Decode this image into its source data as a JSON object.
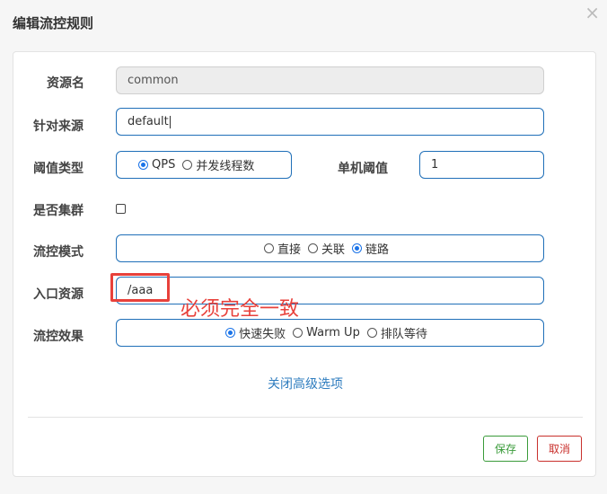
{
  "dialog": {
    "title": "编辑流控规则",
    "close_glyph": "×"
  },
  "form": {
    "resource_name": {
      "label": "资源名",
      "value": "common"
    },
    "limit_app": {
      "label": "针对来源",
      "value": "default"
    },
    "threshold_type": {
      "label": "阈值类型",
      "options": [
        {
          "label": "QPS",
          "checked": true
        },
        {
          "label": "并发线程数",
          "checked": false
        }
      ]
    },
    "single_threshold": {
      "label": "单机阈值",
      "value": "1"
    },
    "cluster_mode": {
      "label": "是否集群",
      "checked": false
    },
    "strategy": {
      "label": "流控模式",
      "options": [
        {
          "label": "直接",
          "checked": false
        },
        {
          "label": "关联",
          "checked": false
        },
        {
          "label": "链路",
          "checked": true
        }
      ]
    },
    "ref_resource": {
      "label": "入口资源",
      "value": "/aaa"
    },
    "control_behavior": {
      "label": "流控效果",
      "options": [
        {
          "label": "快速失败",
          "checked": true
        },
        {
          "label": "Warm Up",
          "checked": false
        },
        {
          "label": "排队等待",
          "checked": false
        }
      ]
    }
  },
  "annotation": {
    "text": "必须完全一致",
    "color": "#e8413b"
  },
  "advanced_toggle": "关闭高级选项",
  "buttons": {
    "save": "保存",
    "cancel": "取消"
  }
}
